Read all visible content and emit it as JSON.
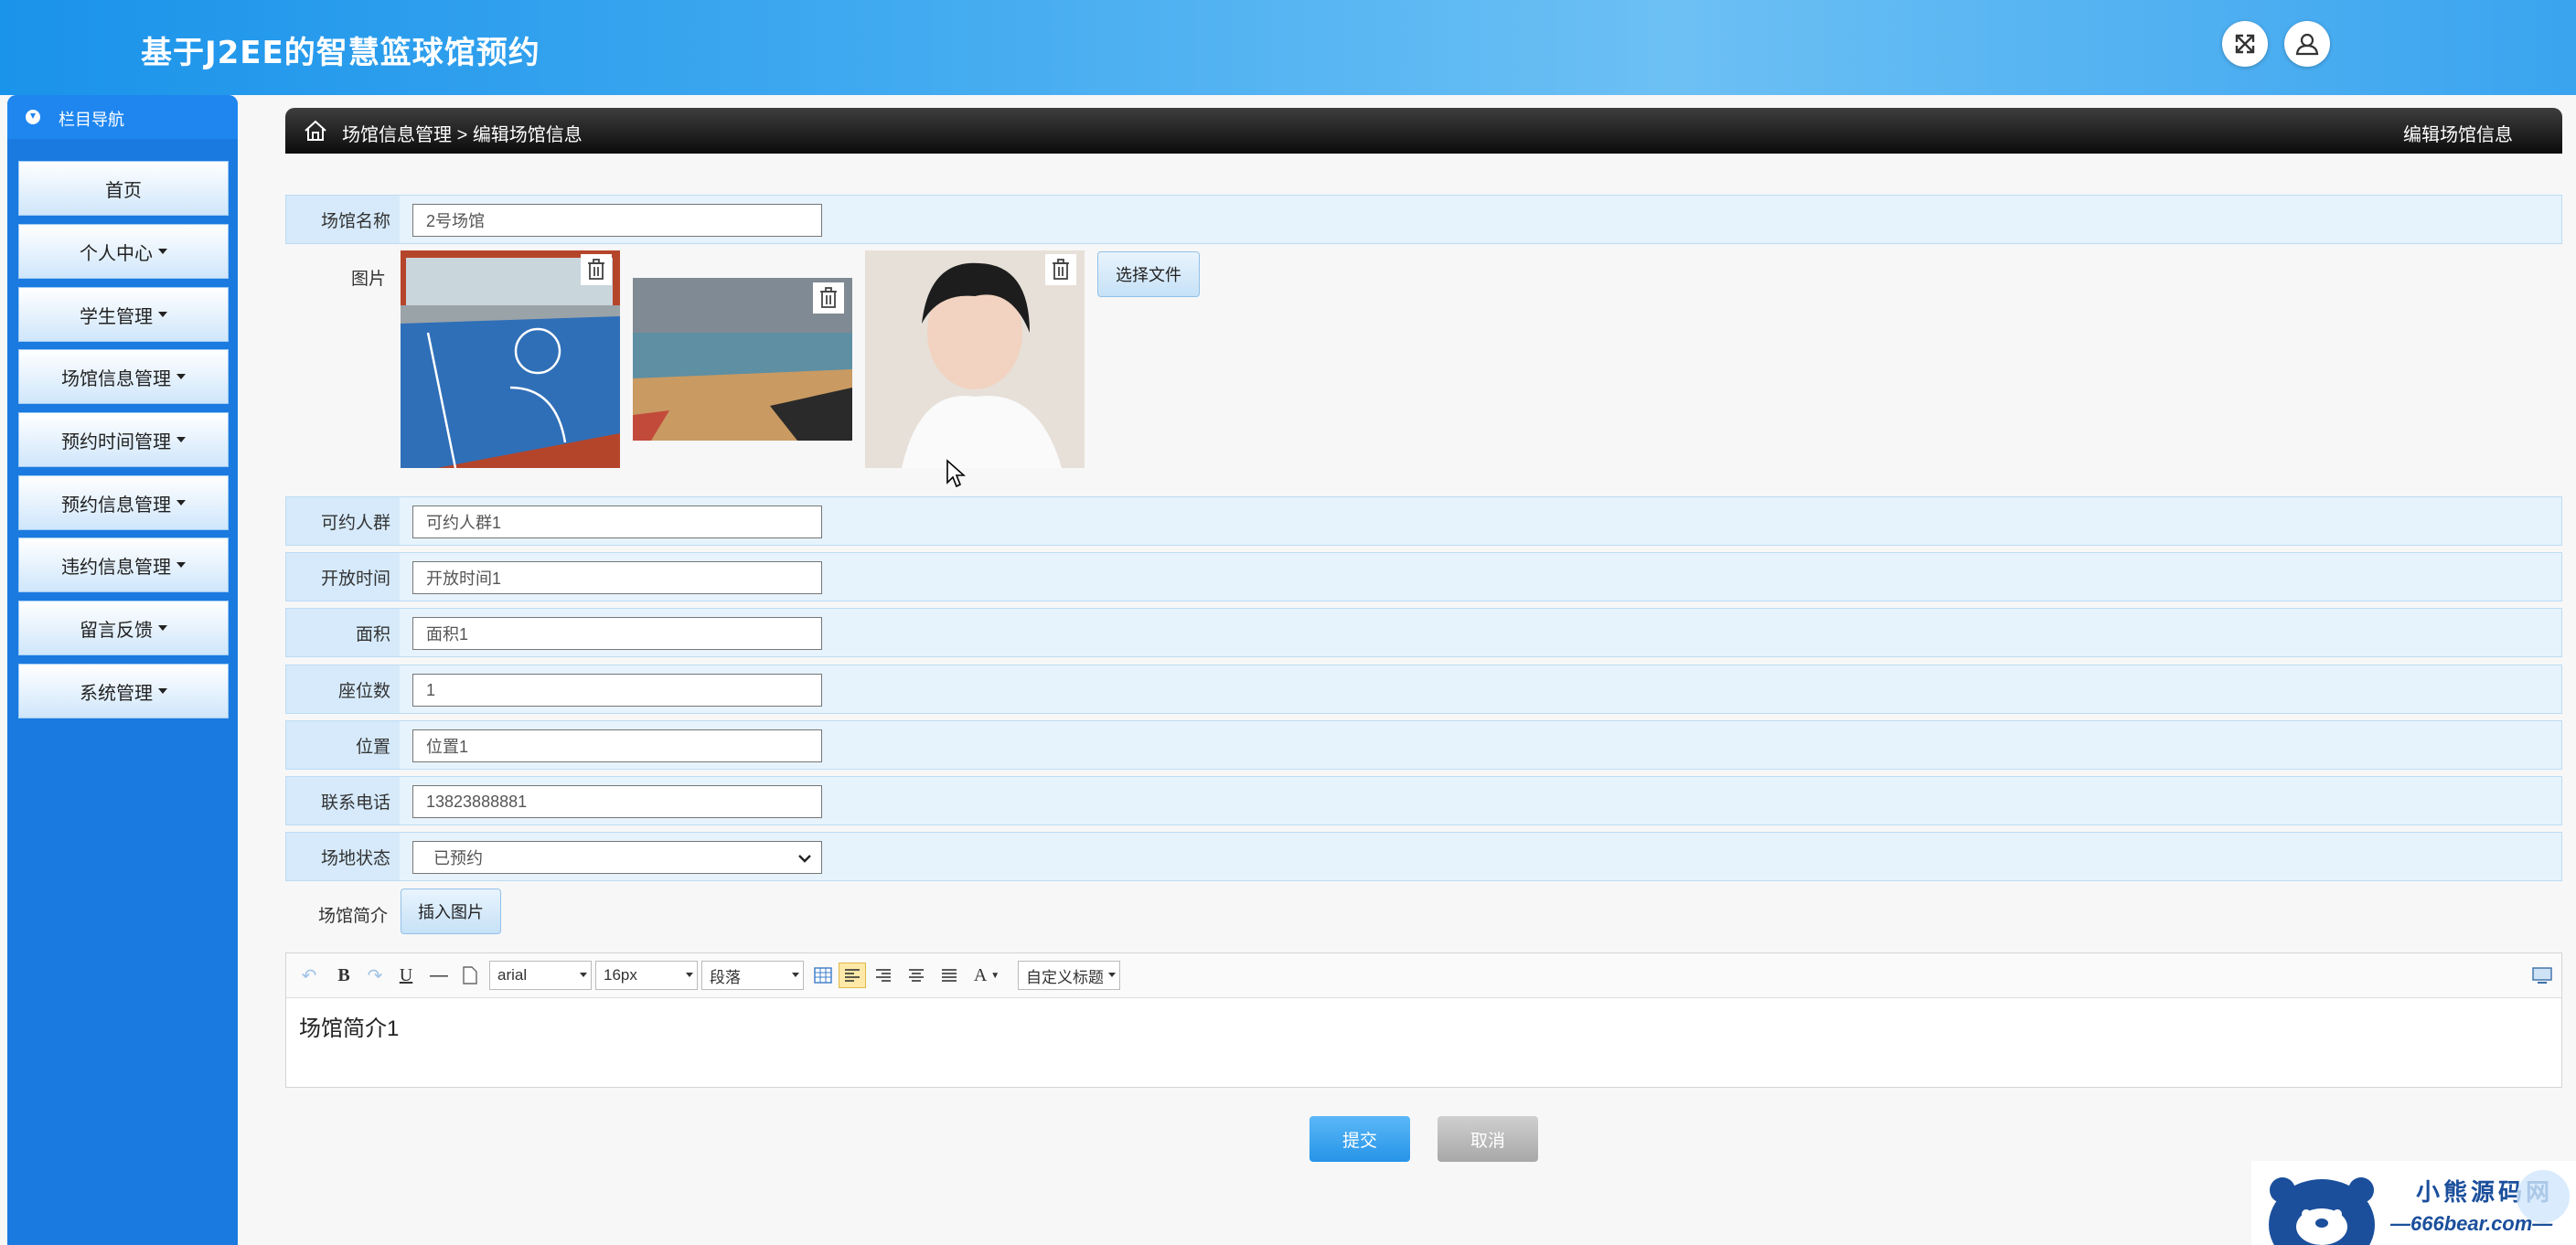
{
  "app": {
    "title": "基于J2EE的智慧篮球馆预约"
  },
  "header": {
    "fullscreen_icon": "expand-icon",
    "user_icon": "user-icon"
  },
  "sidebar": {
    "nav_title": "栏目导航",
    "items": [
      {
        "label": "首页",
        "has_caret": false
      },
      {
        "label": "个人中心",
        "has_caret": true
      },
      {
        "label": "学生管理",
        "has_caret": true
      },
      {
        "label": "场馆信息管理",
        "has_caret": true
      },
      {
        "label": "预约时间管理",
        "has_caret": true
      },
      {
        "label": "预约信息管理",
        "has_caret": true
      },
      {
        "label": "违约信息管理",
        "has_caret": true
      },
      {
        "label": "留言反馈",
        "has_caret": true
      },
      {
        "label": "系统管理",
        "has_caret": true
      }
    ]
  },
  "breadcrumb": {
    "parent": "场馆信息管理",
    "separator": ">",
    "current": "编辑场馆信息",
    "page_title": "编辑场馆信息"
  },
  "form": {
    "venue_name": {
      "label": "场馆名称",
      "value": "2号场馆"
    },
    "images": {
      "label": "图片",
      "choose_file_label": "选择文件",
      "count": 3
    },
    "audience": {
      "label": "可约人群",
      "value": "可约人群1"
    },
    "open_time": {
      "label": "开放时间",
      "value": "开放时间1"
    },
    "area": {
      "label": "面积",
      "value": "面积1"
    },
    "seats": {
      "label": "座位数",
      "value": "1"
    },
    "location": {
      "label": "位置",
      "value": "位置1"
    },
    "phone": {
      "label": "联系电话",
      "value": "13823888881"
    },
    "status": {
      "label": "场地状态",
      "value": "已预约"
    },
    "intro": {
      "label": "场馆简介",
      "insert_image_label": "插入图片"
    }
  },
  "editor": {
    "font_family": "arial",
    "font_size": "16px",
    "paragraph": "段落",
    "custom_title": "自定义标题",
    "content": "场馆简介1"
  },
  "actions": {
    "submit_label": "提交",
    "cancel_label": "取消"
  },
  "watermark": {
    "text_top": "小熊源码网",
    "text_bottom": "—666bear.com—"
  },
  "colors": {
    "header": "#2b9cee",
    "sidebar": "#1a7ae0",
    "row_bg": "#e6f3fd",
    "submit": "#2694e8"
  }
}
